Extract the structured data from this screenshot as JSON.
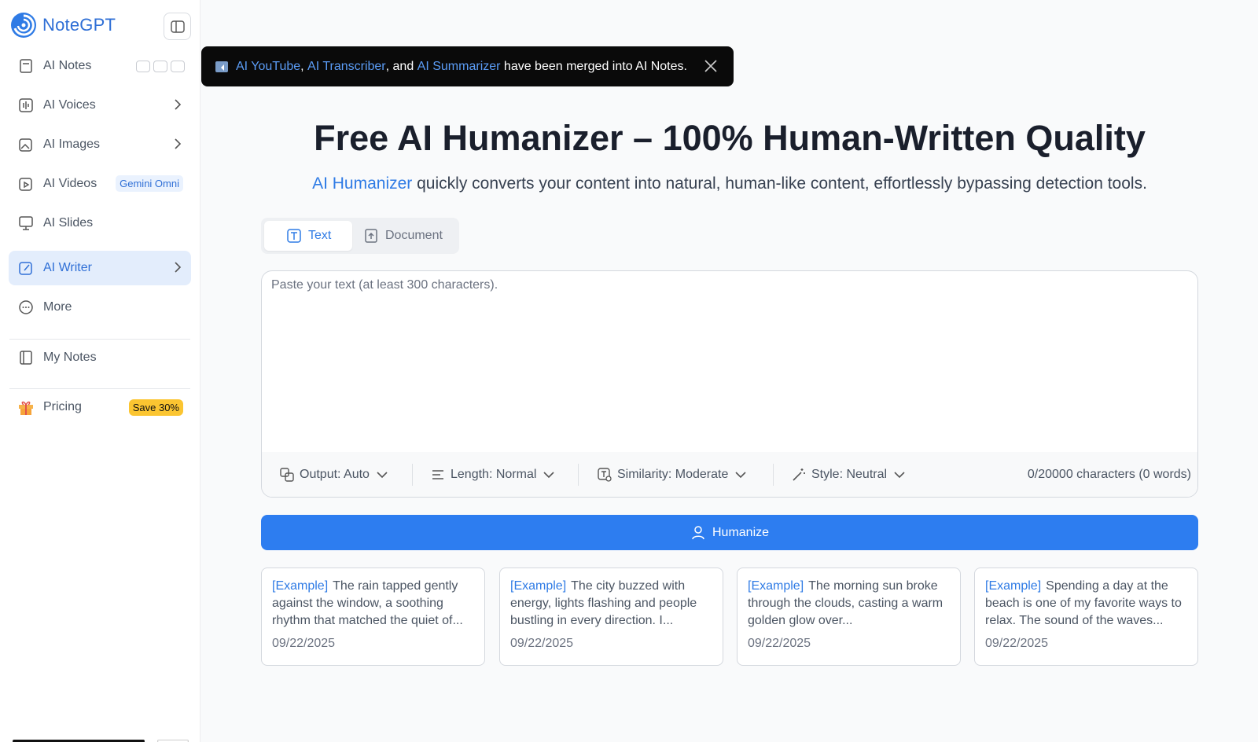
{
  "app": {
    "name": "NoteGPT"
  },
  "sidebar": {
    "items": [
      {
        "label": "AI Notes"
      },
      {
        "label": "AI Voices"
      },
      {
        "label": "AI Images"
      },
      {
        "label": "AI Videos",
        "badge": "Gemini Omni"
      },
      {
        "label": "AI Slides"
      },
      {
        "label": "AI Writer",
        "active": true
      },
      {
        "label": "More"
      },
      {
        "label": "My Notes"
      },
      {
        "label": "Pricing",
        "badge": "Save 30%"
      }
    ]
  },
  "toast": {
    "link1": "AI YouTube",
    "sep1": ", ",
    "link2": "AI Transcriber",
    "sep2": ", and ",
    "link3": "AI Summarizer",
    "rest": " have been merged into AI Notes."
  },
  "main": {
    "title": "Free AI Humanizer – 100% Human-Written Quality",
    "subtitle_link": "AI Humanizer",
    "subtitle_rest": " quickly converts your content into natural, human-like content, effortlessly bypassing detection tools.",
    "tabs": [
      {
        "label": "Text"
      },
      {
        "label": "Document"
      }
    ],
    "input_placeholder": "Paste your text (at least 300 characters).",
    "options": {
      "output": "Output: Auto",
      "length": "Length: Normal",
      "similarity": "Similarity: Moderate",
      "style": "Style: Neutral"
    },
    "counter": "0/20000 characters (0 words)",
    "humanize_label": "Humanize",
    "examples": [
      {
        "tag": "[Example]",
        "text": "The rain tapped gently against the window, a soothing rhythm that matched the quiet of...",
        "date": "09/22/2025"
      },
      {
        "tag": "[Example]",
        "text": "The city buzzed with energy, lights flashing and people bustling in every direction. I...",
        "date": "09/22/2025"
      },
      {
        "tag": "[Example]",
        "text": "The morning sun broke through the clouds, casting a warm golden glow over...",
        "date": "09/22/2025"
      },
      {
        "tag": "[Example]",
        "text": "Spending a day at the beach is one of my favorite ways to relax. The sound of the waves...",
        "date": "09/22/2025"
      }
    ]
  },
  "colors": {
    "accent": "#2d7df0",
    "active_nav_bg": "#e3edfc",
    "save_badge": "#fbc531"
  }
}
